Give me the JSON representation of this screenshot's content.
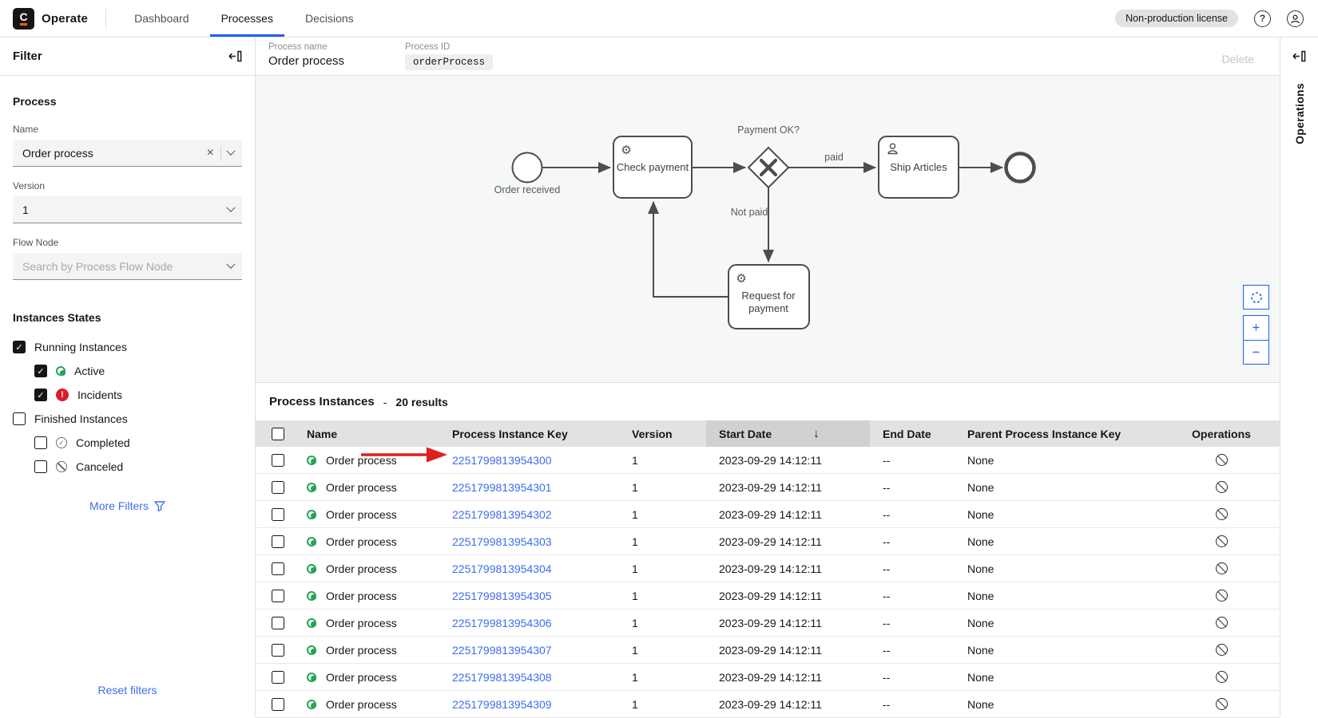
{
  "header": {
    "logo_letter": "C",
    "app_name": "Operate",
    "tabs": [
      {
        "label": "Dashboard",
        "active": false
      },
      {
        "label": "Processes",
        "active": true
      },
      {
        "label": "Decisions",
        "active": false
      }
    ],
    "license_badge": "Non-production license",
    "help_icon": "?",
    "icons": [
      "help-icon",
      "user-avatar-icon"
    ]
  },
  "filter_panel": {
    "title": "Filter",
    "process_heading": "Process",
    "name_label": "Name",
    "name_value": "Order process",
    "version_label": "Version",
    "version_value": "1",
    "flow_node_label": "Flow Node",
    "flow_node_placeholder": "Search by Process Flow Node",
    "states_heading": "Instances States",
    "state_items": [
      {
        "label": "Running Instances",
        "checked": true,
        "indent": false,
        "icon": "none"
      },
      {
        "label": "Active",
        "checked": true,
        "indent": true,
        "icon": "active"
      },
      {
        "label": "Incidents",
        "checked": true,
        "indent": true,
        "icon": "incident"
      },
      {
        "label": "Finished Instances",
        "checked": false,
        "indent": false,
        "icon": "none"
      },
      {
        "label": "Completed",
        "checked": false,
        "indent": true,
        "icon": "completed"
      },
      {
        "label": "Canceled",
        "checked": false,
        "indent": true,
        "icon": "canceled"
      }
    ],
    "more_filters_label": "More Filters",
    "reset_label": "Reset filters"
  },
  "process_panel": {
    "name_label": "Process name",
    "name_value": "Order process",
    "id_label": "Process ID",
    "id_value": "orderProcess",
    "delete_label": "Delete"
  },
  "diagram": {
    "start_event_label": "Order received",
    "task_check_payment": "Check payment",
    "gateway_label": "Payment OK?",
    "edge_paid_label": "paid",
    "edge_not_paid_label": "Not paid",
    "task_ship_articles": "Ship Articles",
    "task_request_line1": "Request for",
    "task_request_line2": "payment",
    "controls": {
      "zoom_in": "+",
      "zoom_out": "−"
    },
    "control_icons": [
      "reset-view-icon",
      "zoom-in-icon",
      "zoom-out-icon"
    ]
  },
  "instances": {
    "title": "Process Instances",
    "separator": "-",
    "results_text": "20 results",
    "sorted_by": "Start Date",
    "sort_direction": "desc",
    "sort_arrow": "↓",
    "columns": [
      "Name",
      "Process Instance Key",
      "Version",
      "Start Date",
      "End Date",
      "Parent Process Instance Key",
      "Operations"
    ],
    "rows": [
      {
        "state": "active",
        "name": "Order process",
        "key": "2251799813954300",
        "version": "1",
        "start": "2023-09-29 14:12:11",
        "end": "--",
        "parent": "None"
      },
      {
        "state": "active",
        "name": "Order process",
        "key": "2251799813954301",
        "version": "1",
        "start": "2023-09-29 14:12:11",
        "end": "--",
        "parent": "None"
      },
      {
        "state": "active",
        "name": "Order process",
        "key": "2251799813954302",
        "version": "1",
        "start": "2023-09-29 14:12:11",
        "end": "--",
        "parent": "None"
      },
      {
        "state": "active",
        "name": "Order process",
        "key": "2251799813954303",
        "version": "1",
        "start": "2023-09-29 14:12:11",
        "end": "--",
        "parent": "None"
      },
      {
        "state": "active",
        "name": "Order process",
        "key": "2251799813954304",
        "version": "1",
        "start": "2023-09-29 14:12:11",
        "end": "--",
        "parent": "None"
      },
      {
        "state": "active",
        "name": "Order process",
        "key": "2251799813954305",
        "version": "1",
        "start": "2023-09-29 14:12:11",
        "end": "--",
        "parent": "None"
      },
      {
        "state": "active",
        "name": "Order process",
        "key": "2251799813954306",
        "version": "1",
        "start": "2023-09-29 14:12:11",
        "end": "--",
        "parent": "None"
      },
      {
        "state": "active",
        "name": "Order process",
        "key": "2251799813954307",
        "version": "1",
        "start": "2023-09-29 14:12:11",
        "end": "--",
        "parent": "None"
      },
      {
        "state": "active",
        "name": "Order process",
        "key": "2251799813954308",
        "version": "1",
        "start": "2023-09-29 14:12:11",
        "end": "--",
        "parent": "None"
      },
      {
        "state": "active",
        "name": "Order process",
        "key": "2251799813954309",
        "version": "1",
        "start": "2023-09-29 14:12:11",
        "end": "--",
        "parent": "None"
      }
    ]
  },
  "right_panel": {
    "title": "Operations"
  },
  "annotation": {
    "type": "red-arrow",
    "points_at": "first-row-instance-key",
    "color": "#e01e1e"
  },
  "colors": {
    "accent_blue": "#2160f0",
    "link_blue": "#3d6cf0",
    "active_green": "#23a455",
    "incident_red": "#da1e28",
    "header_gray": "#e2e2e2",
    "sorted_gray": "#d1d1d1",
    "diagram_bg": "#f6f7f7"
  }
}
